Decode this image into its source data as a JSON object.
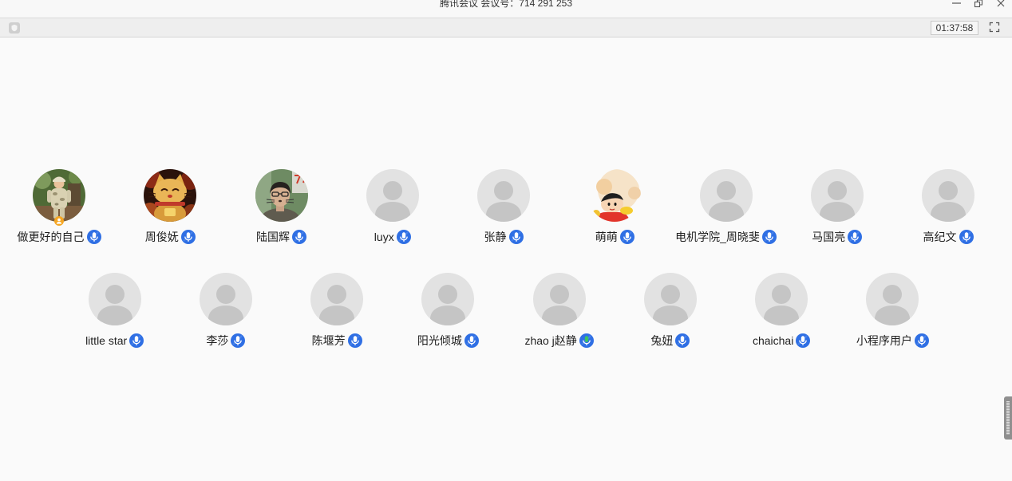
{
  "window": {
    "title": "腾讯会议 会议号：714 291 253",
    "controls": {
      "minimize": "minimize-icon",
      "restore": "restore-icon",
      "close": "close-icon"
    }
  },
  "toolbar": {
    "security_icon": "shield-icon",
    "timer": "01:37:58",
    "fullscreen_icon": "fullscreen-icon"
  },
  "colors": {
    "page_background": "#fafafa",
    "toolbar_background": "#eeeeee",
    "mic_blue": "#2f6fe4",
    "speaking_green": "#3cc463",
    "host_badge": "#f5a623",
    "default_avatar_background": "#e2e2e2",
    "default_avatar_figure": "#c5c5c5"
  },
  "participants": {
    "rows": [
      [
        {
          "name": "做更好的自己",
          "avatar_icon": "photo-avatar-icon",
          "mic_icon": "mic-on-icon",
          "badge_icon": "host-badge-icon"
        },
        {
          "name": "周俊妩",
          "avatar_icon": "photo-avatar-icon",
          "mic_icon": "mic-on-icon"
        },
        {
          "name": "陆国辉",
          "avatar_icon": "photo-avatar-icon",
          "mic_icon": "mic-on-icon"
        },
        {
          "name": "luyx",
          "avatar_icon": "default-avatar-icon",
          "mic_icon": "mic-on-icon"
        },
        {
          "name": "张静",
          "avatar_icon": "default-avatar-icon",
          "mic_icon": "mic-on-icon"
        },
        {
          "name": "萌萌",
          "avatar_icon": "photo-avatar-icon",
          "mic_icon": "mic-on-icon"
        },
        {
          "name": "电机学院_周晓斐",
          "avatar_icon": "default-avatar-icon",
          "mic_icon": "mic-on-icon"
        },
        {
          "name": "马国亮",
          "avatar_icon": "default-avatar-icon",
          "mic_icon": "mic-on-icon"
        },
        {
          "name": "高纪文",
          "avatar_icon": "default-avatar-icon",
          "mic_icon": "mic-on-icon"
        }
      ],
      [
        {
          "name": "little star",
          "avatar_icon": "default-avatar-icon",
          "mic_icon": "mic-on-icon"
        },
        {
          "name": "李莎",
          "avatar_icon": "default-avatar-icon",
          "mic_icon": "mic-on-icon"
        },
        {
          "name": "陈堰芳",
          "avatar_icon": "default-avatar-icon",
          "mic_icon": "mic-on-icon"
        },
        {
          "name": "阳光倾城",
          "avatar_icon": "default-avatar-icon",
          "mic_icon": "mic-on-icon"
        },
        {
          "name": "zhao j赵静",
          "avatar_icon": "default-avatar-icon",
          "mic_icon": "mic-speaking-icon"
        },
        {
          "name": "兔妞",
          "avatar_icon": "default-avatar-icon",
          "mic_icon": "mic-on-icon"
        },
        {
          "name": "chaichai",
          "avatar_icon": "default-avatar-icon",
          "mic_icon": "mic-on-icon"
        },
        {
          "name": "小程序用户",
          "avatar_icon": "default-avatar-icon",
          "mic_icon": "mic-on-icon"
        }
      ]
    ]
  }
}
